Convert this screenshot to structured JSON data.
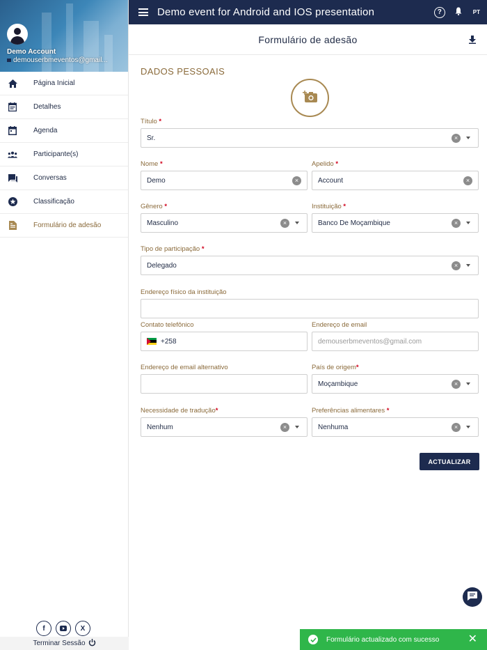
{
  "app": {
    "title": "Demo event for Android and IOS presentation",
    "help_glyph": "?",
    "language": "PT"
  },
  "profile": {
    "name": "Demo Account",
    "email": "demouserbmeventos@gmail..."
  },
  "sidebar": {
    "items": [
      {
        "label": "Página Inicial",
        "icon": "home-icon"
      },
      {
        "label": "Detalhes",
        "icon": "calendar-details-icon"
      },
      {
        "label": "Agenda",
        "icon": "calendar-icon"
      },
      {
        "label": "Participante(s)",
        "icon": "people-icon"
      },
      {
        "label": "Conversas",
        "icon": "chat-icon"
      },
      {
        "label": "Classificação",
        "icon": "star-badge-icon"
      },
      {
        "label": "Formulário de adesão",
        "icon": "document-icon"
      }
    ],
    "social": [
      "f",
      "youtube",
      "X"
    ],
    "social_labels": {
      "facebook": "f",
      "x": "X"
    },
    "logout_label": "Terminar Sessão"
  },
  "form": {
    "header": "Formulário de adesão",
    "section": "DADOS PESSOAIS",
    "fields": {
      "titulo": {
        "label": "Título",
        "required": "*",
        "value": "Sr."
      },
      "nome": {
        "label": "Nome",
        "required": "*",
        "value": "Demo"
      },
      "apelido": {
        "label": "Apelido",
        "required": "*",
        "value": "Account"
      },
      "genero": {
        "label": "Gênero",
        "required": "*",
        "value": "Masculino"
      },
      "instituicao": {
        "label": "Instituição",
        "required": "*",
        "value": "Banco De Moçambique"
      },
      "tipo": {
        "label": "Tipo de participação",
        "required": "*",
        "value": "Delegado"
      },
      "endereco_fisico": {
        "label": "Endereço físico da instituição",
        "value": ""
      },
      "contato": {
        "label": "Contato telefônico",
        "value": "+258"
      },
      "email": {
        "label": "Endereço de email",
        "value": "demouserbmeventos@gmail.com"
      },
      "email_alt": {
        "label": "Endereço de email alternativo",
        "value": ""
      },
      "pais": {
        "label": "País de origem",
        "required": "*",
        "value": "Moçambique"
      },
      "traducao": {
        "label": "Necessidade de tradução",
        "required": "*",
        "value": "Nenhum"
      },
      "alimentar": {
        "label": "Preferências alimentares",
        "required": "*",
        "value": "Nenhuma"
      }
    },
    "clear_glyph": "×",
    "submit_label": "ACTUALIZAR"
  },
  "toast": {
    "message": "Formulário actualizado com sucesso",
    "close_glyph": "✕"
  },
  "colors": {
    "primary": "#1d2b4f",
    "accent": "#8a6a3a",
    "required": "#d0021b",
    "success": "#2fb64a"
  }
}
